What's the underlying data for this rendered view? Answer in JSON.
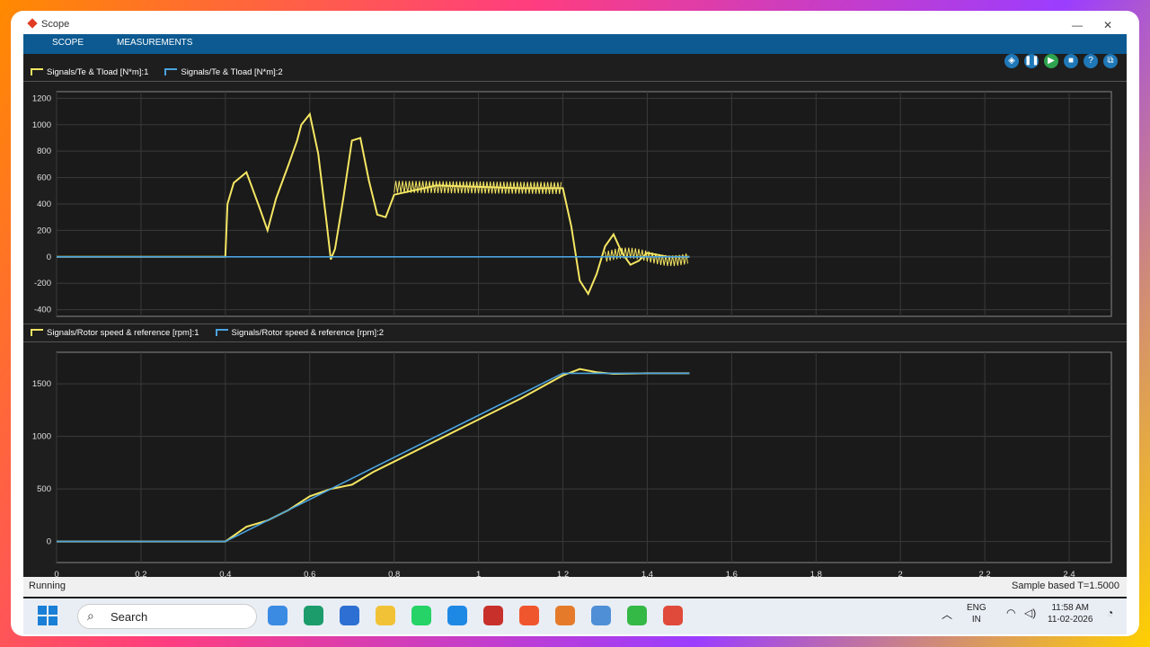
{
  "window": {
    "title": "Scope",
    "min": "—",
    "close": "✕"
  },
  "menubar": {
    "tabs": [
      {
        "label": "SCOPE"
      },
      {
        "label": "MEASUREMENTS"
      }
    ]
  },
  "toolbar": {
    "icons": [
      "highlight-simulink-block-icon",
      "pause-icon",
      "step-forward-icon",
      "stop-icon",
      "help-icon",
      "undock-icon"
    ]
  },
  "legend1": [
    {
      "label": "Signals/Te & Tload [N*m]:1",
      "color": "#f5e663"
    },
    {
      "label": "Signals/Te & Tload [N*m]:2",
      "color": "#4aa3df"
    }
  ],
  "legend2": [
    {
      "label": "Signals/Rotor speed & reference [rpm]:1",
      "color": "#f5e663"
    },
    {
      "label": "Signals/Rotor speed & reference [rpm]:2",
      "color": "#4aa3df"
    }
  ],
  "chart_data": [
    {
      "type": "line",
      "xlim": [
        0,
        2.5
      ],
      "ylim": [
        -450,
        1250
      ],
      "yticks": [
        "1200",
        "1000",
        "800",
        "600",
        "400",
        "200",
        "0",
        "-200",
        "-400"
      ],
      "grid": true,
      "legend_placement": "top-left",
      "series": [
        {
          "name": "Signals/Te & Tload [N*m]:1",
          "color": "#f5e663",
          "x": [
            0,
            0.4,
            0.405,
            0.42,
            0.45,
            0.48,
            0.5,
            0.52,
            0.55,
            0.57,
            0.58,
            0.6,
            0.62,
            0.64,
            0.65,
            0.66,
            0.68,
            0.7,
            0.72,
            0.74,
            0.76,
            0.78,
            0.8,
            0.9,
            1.0,
            1.1,
            1.2,
            1.22,
            1.24,
            1.26,
            1.28,
            1.3,
            1.32,
            1.34,
            1.36,
            1.38,
            1.4,
            1.45,
            1.5
          ],
          "y": [
            0,
            0,
            400,
            560,
            640,
            380,
            200,
            440,
            700,
            880,
            1000,
            1080,
            780,
            260,
            -20,
            60,
            450,
            880,
            900,
            580,
            320,
            300,
            470,
            540,
            530,
            520,
            520,
            230,
            -180,
            -280,
            -130,
            80,
            170,
            30,
            -60,
            -30,
            30,
            0,
            0
          ]
        },
        {
          "name": "Signals/Te & Tload [N*m]:2",
          "color": "#4aa3df",
          "x": [
            0,
            1.5
          ],
          "y": [
            0,
            0
          ]
        }
      ]
    },
    {
      "type": "line",
      "xlim": [
        0,
        2.5
      ],
      "ylim": [
        -200,
        1800
      ],
      "xticks": [
        "0",
        "0.2",
        "0.4",
        "0.6",
        "0.8",
        "1",
        "1.2",
        "1.4",
        "1.6",
        "1.8",
        "2",
        "2.2",
        "2.4"
      ],
      "yticks": [
        "1500",
        "1000",
        "500",
        "0"
      ],
      "grid": true,
      "legend_placement": "top-left",
      "series": [
        {
          "name": "Signals/Rotor speed & reference [rpm]:1",
          "color": "#f5e663",
          "x": [
            0,
            0.4,
            0.45,
            0.5,
            0.55,
            0.6,
            0.65,
            0.7,
            0.75,
            0.8,
            0.9,
            1.0,
            1.1,
            1.2,
            1.24,
            1.28,
            1.32,
            1.4,
            1.5
          ],
          "y": [
            0,
            0,
            140,
            200,
            300,
            430,
            500,
            540,
            660,
            760,
            960,
            1160,
            1360,
            1580,
            1640,
            1610,
            1595,
            1600,
            1600
          ]
        },
        {
          "name": "Signals/Rotor speed & reference [rpm]:2",
          "color": "#4aa3df",
          "x": [
            0,
            0.4,
            1.2,
            1.5
          ],
          "y": [
            0,
            0,
            1600,
            1600
          ]
        }
      ]
    }
  ],
  "status": {
    "left": "Running",
    "right": "Sample based    T=1.5000"
  },
  "taskbar": {
    "search_placeholder": "Search",
    "lang": "ENG",
    "region": "IN",
    "time": "11:58 AM",
    "date": "11-02-2026",
    "apps": [
      "file-explorer-icon",
      "settings-icon",
      "mail-icon",
      "folder-icon",
      "whatsapp-icon",
      "vscode-icon",
      "filezilla-icon",
      "brave-icon",
      "matlab-icon",
      "photos-icon",
      "camtasia-icon",
      "recorder-icon"
    ]
  }
}
